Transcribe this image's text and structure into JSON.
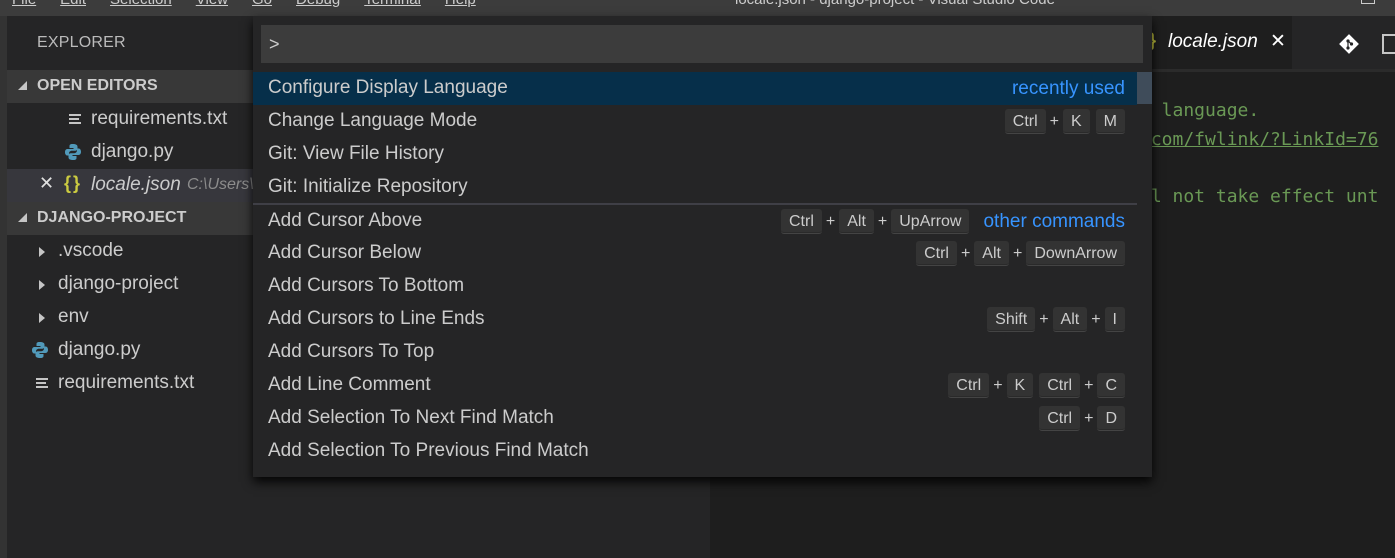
{
  "menubar": {
    "items": [
      "File",
      "Edit",
      "Selection",
      "View",
      "Go",
      "Debug",
      "Terminal",
      "Help"
    ],
    "title": "locale.json - django-project - Visual Studio Code"
  },
  "sidebar": {
    "title": "EXPLORER",
    "open_editors": {
      "label": "OPEN EDITORS",
      "items": [
        {
          "name": "requirements.txt",
          "icon": "lines-icon"
        },
        {
          "name": "django.py",
          "icon": "python-icon"
        },
        {
          "name": "locale.json",
          "path": "C:\\Users\\",
          "icon": "json-icon",
          "active": true
        }
      ]
    },
    "project": {
      "label": "DJANGO-PROJECT",
      "items": [
        {
          "name": ".vscode",
          "type": "folder"
        },
        {
          "name": "django-project",
          "type": "folder"
        },
        {
          "name": "env",
          "type": "folder"
        },
        {
          "name": "django.py",
          "type": "python"
        },
        {
          "name": "requirements.txt",
          "type": "text"
        }
      ]
    }
  },
  "editor": {
    "tab": {
      "label": "locale.json",
      "icon": "{}",
      "close": "✕"
    },
    "lines": [
      "/ language.",
      ".com/fwlink/?LinkId=76",
      "ll not take effect unt"
    ]
  },
  "palette": {
    "input_value": ">",
    "items": [
      {
        "label": "Configure Display Language",
        "hint": "recently used",
        "keys": []
      },
      {
        "label": "Change Language Mode",
        "keys": [
          [
            "Ctrl",
            "K"
          ],
          [
            "M"
          ]
        ]
      },
      {
        "label": "Git: View File History",
        "keys": []
      },
      {
        "label": "Git: Initialize Repository",
        "keys": []
      },
      {
        "label": "Add Cursor Above",
        "keys": [
          [
            "Ctrl",
            "Alt",
            "UpArrow"
          ]
        ],
        "hint": "other commands"
      },
      {
        "label": "Add Cursor Below",
        "keys": [
          [
            "Ctrl",
            "Alt",
            "DownArrow"
          ]
        ]
      },
      {
        "label": "Add Cursors To Bottom",
        "keys": []
      },
      {
        "label": "Add Cursors to Line Ends",
        "keys": [
          [
            "Shift",
            "Alt",
            "I"
          ]
        ]
      },
      {
        "label": "Add Cursors To Top",
        "keys": []
      },
      {
        "label": "Add Line Comment",
        "keys": [
          [
            "Ctrl",
            "K"
          ],
          [
            "Ctrl",
            "C"
          ]
        ]
      },
      {
        "label": "Add Selection To Next Find Match",
        "keys": [
          [
            "Ctrl",
            "D"
          ]
        ]
      },
      {
        "label": "Add Selection To Previous Find Match",
        "keys": []
      }
    ],
    "plus": "+"
  },
  "colors": {
    "accent_hint": "#3794ff",
    "selection_bg": "#062f4a",
    "comment_green": "#6a9955",
    "json_yellow": "#cbcb41"
  }
}
